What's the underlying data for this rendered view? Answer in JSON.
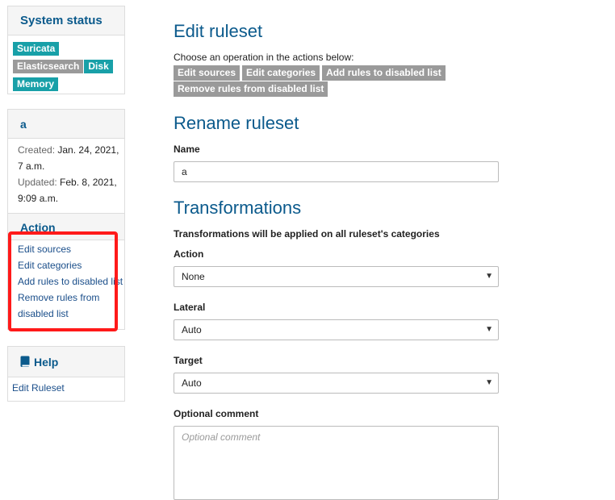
{
  "sidebar": {
    "status": {
      "title": "System status",
      "badges": [
        {
          "label": "Suricata",
          "state": "ok"
        },
        {
          "label": "Elasticsearch",
          "state": "off"
        },
        {
          "label": "Disk",
          "state": "ok"
        },
        {
          "label": "Memory",
          "state": "ok"
        }
      ]
    },
    "ruleset": {
      "name": "a",
      "created_label": "Created:",
      "created_value": "Jan. 24, 2021, 7 a.m.",
      "updated_label": "Updated:",
      "updated_value": "Feb. 8, 2021, 9:09 a.m.",
      "action_title": "Action",
      "actions": [
        "Edit sources",
        "Edit categories",
        "Add rules to disabled list",
        "Remove rules from disabled list"
      ]
    },
    "help": {
      "title": "Help",
      "link": "Edit Ruleset"
    }
  },
  "main": {
    "title": "Edit ruleset",
    "intro": "Choose an operation in the actions below:",
    "operations": [
      "Edit sources",
      "Edit categories",
      "Add rules to disabled list",
      "Remove rules from disabled list"
    ],
    "rename_title": "Rename ruleset",
    "name_label": "Name",
    "name_value": "a",
    "transformations_title": "Transformations",
    "transformations_note": "Transformations will be applied on all ruleset's categories",
    "action_label": "Action",
    "action_value": "None",
    "lateral_label": "Lateral",
    "lateral_value": "Auto",
    "target_label": "Target",
    "target_value": "Auto",
    "comment_label": "Optional comment",
    "comment_placeholder": "Optional comment"
  },
  "colors": {
    "heading": "#0b5a8c",
    "badge_ok": "#18a0a8",
    "badge_off": "#9a9a9a",
    "highlight": "#ff1a1a"
  }
}
